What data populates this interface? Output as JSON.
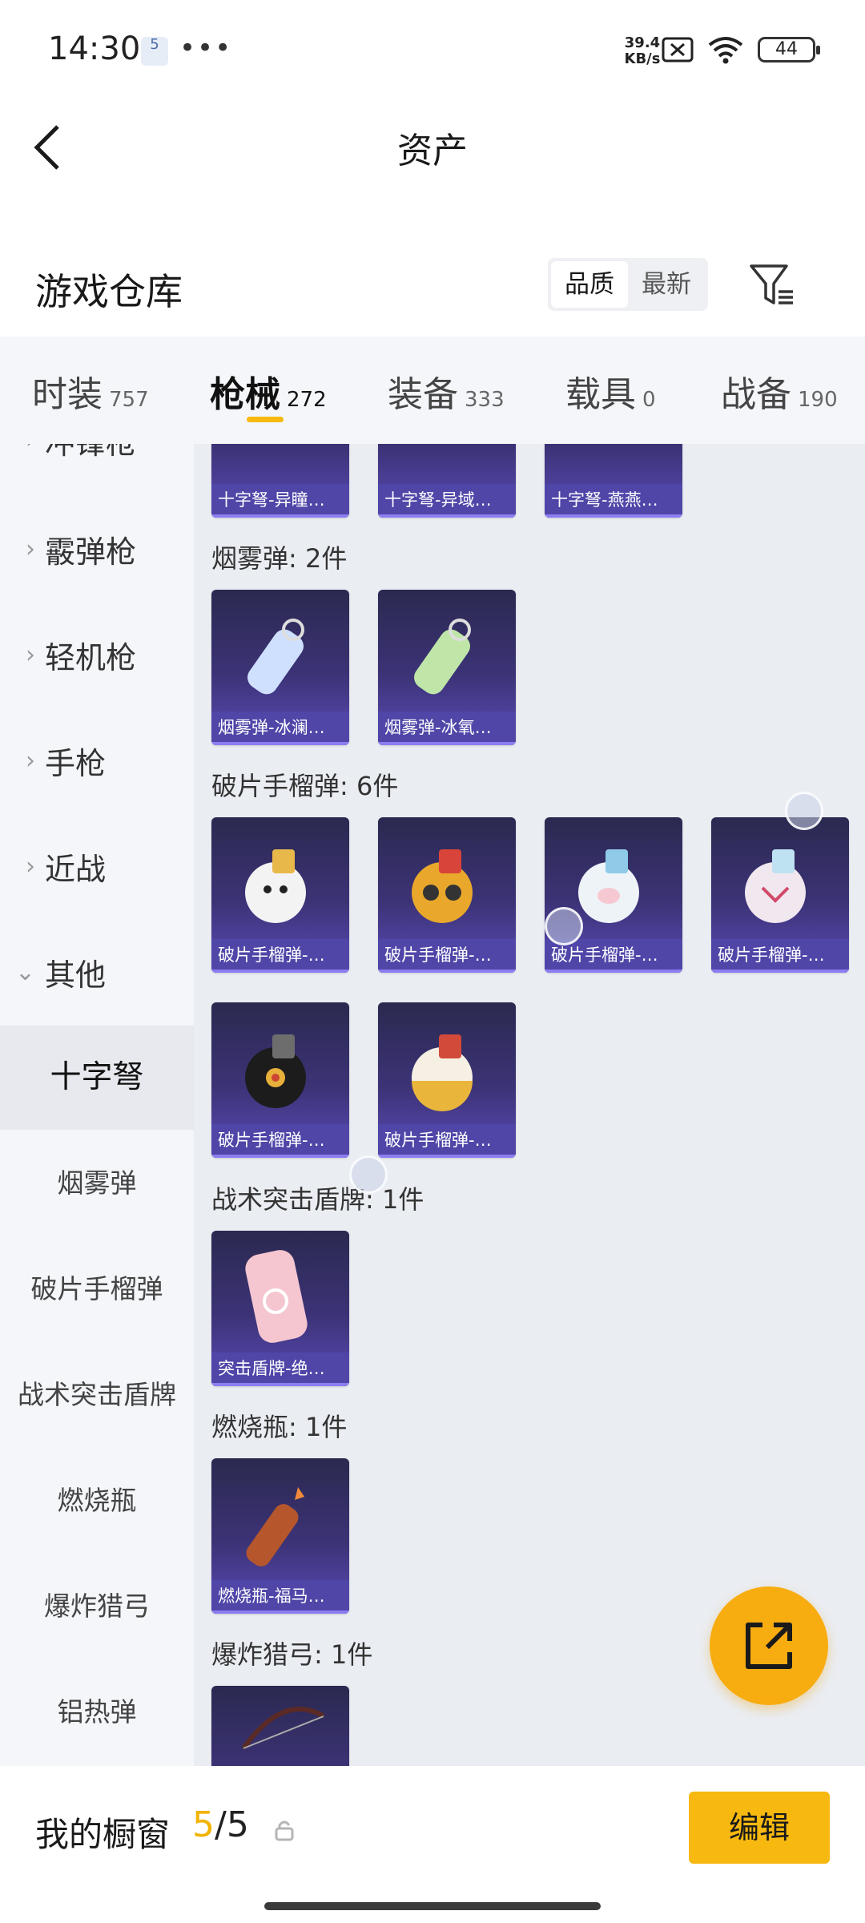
{
  "status": {
    "time": "14:30",
    "notif": "5",
    "dots": "•••",
    "speed": "39.4\nKB/s",
    "battery": "44"
  },
  "header": {
    "title": "资产"
  },
  "warehouse": {
    "title": "游戏仓库",
    "sort": [
      "品质",
      "最新"
    ]
  },
  "tabs": [
    {
      "label": "时装",
      "count": "757"
    },
    {
      "label": "枪械",
      "count": "272"
    },
    {
      "label": "装备",
      "count": "333"
    },
    {
      "label": "载具",
      "count": "0"
    },
    {
      "label": "战备",
      "count": "190"
    }
  ],
  "sidebar": {
    "top_partial": "冲锋枪",
    "categories": [
      "霰弹枪",
      "轻机枪",
      "手枪",
      "近战"
    ],
    "expanded": "其他",
    "sub": [
      "十字弩",
      "烟雾弹",
      "破片手榴弹",
      "战术突击盾牌",
      "燃烧瓶",
      "爆炸猎弓",
      "铝热弹"
    ]
  },
  "sections": {
    "crossbow_items": [
      "十字弩-异瞳…",
      "十字弩-异域…",
      "十字弩-燕燕…"
    ],
    "smoke": {
      "heading": "烟雾弹: 2件",
      "items": [
        "烟雾弹-冰澜…",
        "烟雾弹-冰氧…"
      ]
    },
    "frag": {
      "heading": "破片手榴弹: 6件",
      "items": [
        "破片手榴弹-…",
        "破片手榴弹-…",
        "破片手榴弹-…",
        "破片手榴弹-…",
        "破片手榴弹-…",
        "破片手榴弹-…"
      ]
    },
    "shield": {
      "heading": "战术突击盾牌: 1件",
      "items": [
        "突击盾牌-绝…"
      ]
    },
    "molotov": {
      "heading": "燃烧瓶: 1件",
      "items": [
        "燃烧瓶-福马…"
      ]
    },
    "bow": {
      "heading": "爆炸猎弓: 1件"
    }
  },
  "bottom": {
    "window_title": "我的橱窗",
    "current": "5",
    "sep_total": "/5",
    "edit": "编辑"
  }
}
